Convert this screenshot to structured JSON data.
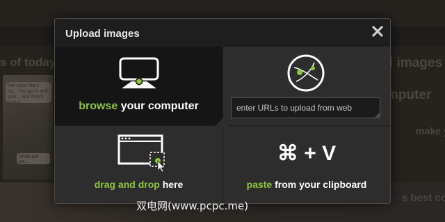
{
  "background": {
    "headline_left": "s of today, e",
    "headline_right": "l images",
    "button_right": "mputer",
    "text_right_1": "make y",
    "text_right_2": "s best co",
    "bubble_1": "I've seen them ca... You go in and pret... and they'll give y...",
    "bubble_2": "What are ca..."
  },
  "dialog": {
    "title": "Upload images",
    "close_icon": "close-icon",
    "browse": {
      "highlight": "browse",
      "rest": " your computer",
      "icon": "computer-monitor-icon"
    },
    "url": {
      "placeholder": "enter URLs to upload from web",
      "icon": "globe-link-icon"
    },
    "drag": {
      "highlight": "drag and drop",
      "rest": " here",
      "icon": "browser-window-drop-icon"
    },
    "paste": {
      "shortcut": "⌘ + V",
      "highlight": "paste",
      "rest": " from your clipboard"
    }
  },
  "watermark": "双电网(www.pcpc.me)",
  "colors": {
    "accent": "#8dc63f",
    "dialog_bg": "#1e1e1e",
    "panel_bg": "#2d2d2d"
  }
}
